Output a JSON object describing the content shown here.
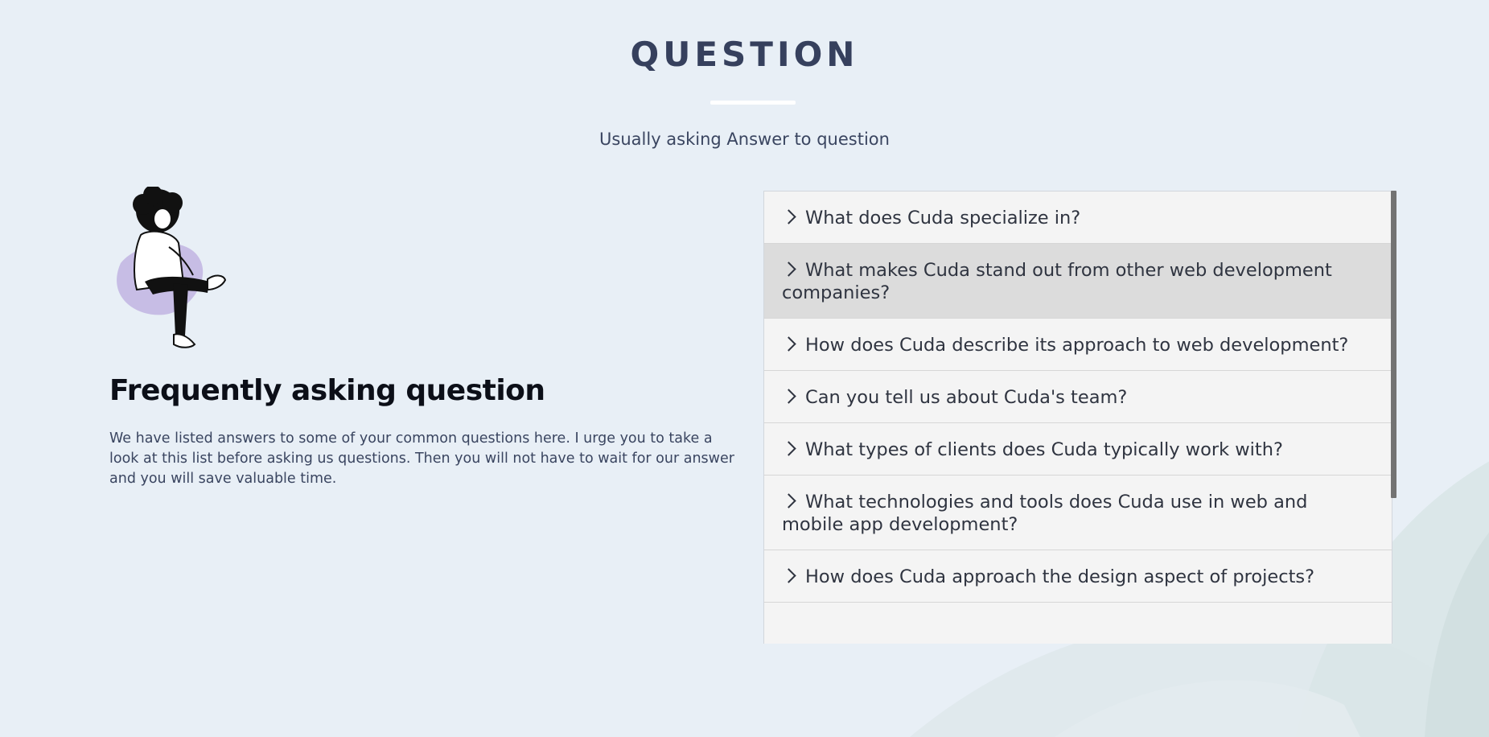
{
  "header": {
    "title": "QUESTION",
    "subtitle": "Usually asking Answer to question"
  },
  "intro": {
    "heading": "Frequently asking question",
    "text": "We have listed answers to some of your common questions here. I urge you to take a look at this list before asking us questions. Then you will not have to wait for our answer and you will save valuable time."
  },
  "faq": {
    "items": [
      {
        "question": "What does Cuda specialize in?",
        "active": false
      },
      {
        "question": "What makes Cuda stand out from other web development companies?",
        "active": true
      },
      {
        "question": "How does Cuda describe its approach to web development?",
        "active": false
      },
      {
        "question": "Can you tell us about Cuda's team?",
        "active": false
      },
      {
        "question": "What types of clients does Cuda typically work with?",
        "active": false
      },
      {
        "question": "What technologies and tools does Cuda use in web and mobile app development?",
        "active": false
      },
      {
        "question": "How does Cuda approach the design aspect of projects?",
        "active": false
      }
    ]
  },
  "colors": {
    "background": "#e8eff6",
    "title": "#36405d",
    "accordion_bg": "#f4f4f4",
    "accordion_active_bg": "#dcdcdc",
    "blob": "#c7bde5"
  },
  "icons": {
    "accordion_toggle": "chevron-right-icon"
  }
}
